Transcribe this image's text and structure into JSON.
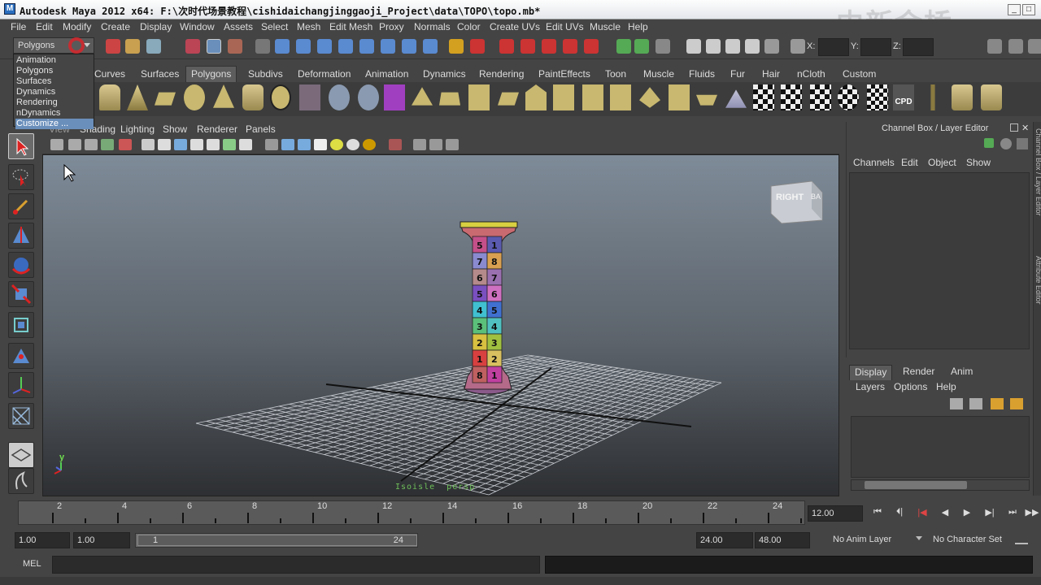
{
  "window": {
    "title": "Autodesk Maya 2012 x64: F:\\次时代场景教程\\cishidaichangjinggaoji_Project\\data\\TOPO\\topo.mb*",
    "watermark": "中新金桥"
  },
  "menubar": [
    "File",
    "Edit",
    "Modify",
    "Create",
    "Display",
    "Window",
    "Assets",
    "Select",
    "Mesh",
    "Edit Mesh",
    "Proxy",
    "Normals",
    "Color",
    "Create UVs",
    "Edit UVs",
    "Muscle",
    "Help"
  ],
  "status_line": {
    "menu_set": "Polygons",
    "coord_labels": [
      "X:",
      "Y:",
      "Z:"
    ]
  },
  "menu_set_dropdown": {
    "items": [
      "Animation",
      "Polygons",
      "Surfaces",
      "Dynamics",
      "Rendering",
      "nDynamics",
      "Customize ..."
    ],
    "highlighted": "Customize ..."
  },
  "shelf": {
    "tabs": [
      "Curves",
      "Surfaces",
      "Polygons",
      "Subdivs",
      "Deformation",
      "Animation",
      "Dynamics",
      "Rendering",
      "PaintEffects",
      "Toon",
      "Muscle",
      "Fluids",
      "Fur",
      "Hair",
      "nCloth",
      "Custom"
    ],
    "active_tab": "Polygons",
    "icon_label_cpd": "CPD"
  },
  "panel_menu": [
    "View",
    "Shading",
    "Lighting",
    "Show",
    "Renderer",
    "Panels"
  ],
  "viewport": {
    "view_cube_label": "RIGHT",
    "view_cube_side": "BA",
    "axis_label": "y",
    "status_label": "Isoisle  persp",
    "uv_numbers": [
      [
        "5",
        "1"
      ],
      [
        "7",
        "8"
      ],
      [
        "6",
        "7"
      ],
      [
        "5",
        "6"
      ],
      [
        "4",
        "5"
      ],
      [
        "3",
        "4"
      ],
      [
        "2",
        "3"
      ],
      [
        "1",
        "2"
      ],
      [
        "8",
        "1"
      ]
    ]
  },
  "channel_box": {
    "title": "Channel Box / Layer Editor",
    "menu": [
      "Channels",
      "Edit",
      "Object",
      "Show"
    ],
    "side_tabs": [
      "Channel Box / Layer Editor",
      "Attribute Editor"
    ]
  },
  "layer_editor": {
    "tabs": [
      "Display",
      "Render",
      "Anim"
    ],
    "active_tab": "Display",
    "menu": [
      "Layers",
      "Options",
      "Help"
    ]
  },
  "time_slider": {
    "tick_labels": [
      "2",
      "4",
      "6",
      "8",
      "10",
      "12",
      "14",
      "16",
      "18",
      "20",
      "22",
      "24"
    ],
    "current_time": "12.00",
    "playback_buttons": [
      "⏮",
      "⏴|",
      "|◀",
      "◀",
      "▶",
      "▶|",
      "⏭",
      "▶▶"
    ]
  },
  "range_slider": {
    "start_time": "1.00",
    "playback_start": "1.00",
    "range_start": "1",
    "range_end": "24",
    "playback_end": "24.00",
    "end_time": "48.00",
    "anim_layer": "No Anim Layer",
    "character_set": "No Character Set"
  },
  "command_line": {
    "label": "MEL"
  }
}
